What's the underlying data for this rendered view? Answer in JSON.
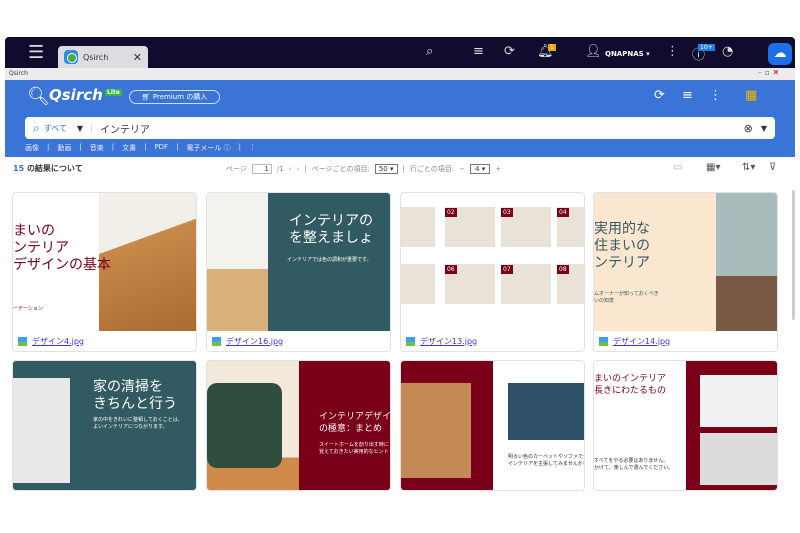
{
  "os": {
    "tab_title": "Qsirch",
    "user": "QNAPNAS",
    "notification_count": "1",
    "update_badge": "10+"
  },
  "window": {
    "title": "Qsirch"
  },
  "app": {
    "brand": "Qsirch",
    "edition": "Lite",
    "premium_button": "Premium の購入"
  },
  "search": {
    "scope": "すべて",
    "query": "インテリア"
  },
  "filters": [
    "画像",
    "動画",
    "音楽",
    "文書",
    "PDF",
    "電子メール"
  ],
  "toolbar": {
    "count": "15",
    "count_suffix": "の結果について",
    "page_label": "ページ",
    "page_value": "1",
    "page_total": "/1",
    "per_page_label": "ページごとの項目:",
    "per_page_value": "50",
    "per_row_label": "行ごとの項目:",
    "per_row_value": "4"
  },
  "results": [
    {
      "file": "デザイン4.jpg",
      "text": "まいの\nンテリア\nデザインの基本",
      "sub": "ーテーション"
    },
    {
      "file": "デザイン16.jpg",
      "text": "インテリアの\nを整えましょ",
      "sub": "インテリアでは色の調和が重要です。"
    },
    {
      "file": "デザイン13.jpg",
      "text": "",
      "sub": "",
      "nums": [
        "02",
        "03",
        "04",
        "06",
        "07",
        "08"
      ]
    },
    {
      "file": "デザイン14.jpg",
      "text": "実用的な\n住まいの\nンテリア",
      "sub": "ムオーナーが知っておくべき\nいの知恵"
    },
    {
      "text": "家の清掃を\nきちんと行う",
      "sub": "家の中をきれいに整頓しておくことは、\nよいインテリアにつながります。"
    },
    {
      "text": "インテリアデザイ\nの極意：まとめ",
      "sub": "スイートホームを創り出す時に\n覚えておきたい実用的なヒント"
    },
    {
      "text": "",
      "sub": "明るい色のカーペットやソファで大胆に\nインテリアを主張してみませんか?"
    },
    {
      "text": "まいのインテリア\n長きにわたるもの",
      "sub": "すべてをやる必要はありません。\nかけて、楽しんで選んでください。"
    }
  ]
}
